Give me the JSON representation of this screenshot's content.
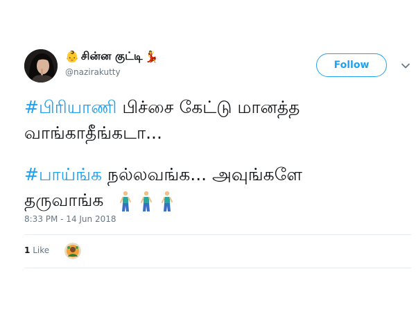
{
  "tweet": {
    "author": {
      "display_name": "சின்ன குட்டி",
      "name_emoji_left": "👶",
      "name_emoji_right": "💃",
      "handle": "@nazirakutty"
    },
    "follow_label": "Follow",
    "text": {
      "line1_hashtag": "#பிரியாணி",
      "line1_rest": " பிச்சை கேட்டு மானத்த",
      "line2": "வாங்காதீங்கடா...",
      "line3_hashtag": "#பாய்ங்க",
      "line3_rest": " நல்லவங்க... அவுங்களே",
      "line4": "தருவாங்க",
      "line4_emojis": [
        "🚶",
        "🚶",
        "🚶"
      ]
    },
    "timestamp": "8:33 PM - 14 Jun 2018",
    "likes": {
      "count": "1",
      "label": "Like"
    },
    "icons": {
      "menu": "chevron-down-icon",
      "walker": "person-walking-icon"
    },
    "colors": {
      "accent": "#1da1f2",
      "text": "#14171a",
      "muted": "#657786"
    }
  }
}
